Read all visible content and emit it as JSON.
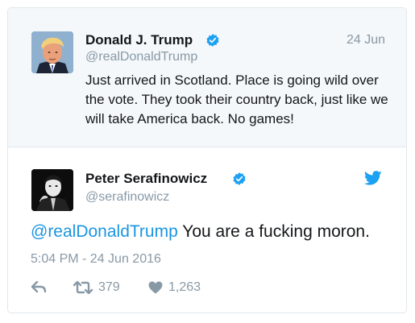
{
  "quoted_tweet": {
    "name": "Donald J. Trump",
    "handle": "@realDonaldTrump",
    "date": "24 Jun",
    "text": "Just arrived in Scotland. Place is going wild over the vote. They took their country back, just like we will take America back. No games!"
  },
  "reply_tweet": {
    "name": "Peter Serafinowicz",
    "handle": "@serafinowicz",
    "mention": "@realDonaldTrump",
    "text": " You are a fucking moron.",
    "timestamp": "5:04 PM - 24 Jun 2016",
    "retweet_count": "379",
    "like_count": "1,263"
  },
  "colors": {
    "accent": "#1b95e0",
    "muted": "#8899a6",
    "quoted_bg": "#f5f8fa",
    "border": "#e1e8ed"
  },
  "icons": [
    "verified-badge-icon",
    "twitter-bird-icon",
    "reply-icon",
    "retweet-icon",
    "heart-icon"
  ]
}
